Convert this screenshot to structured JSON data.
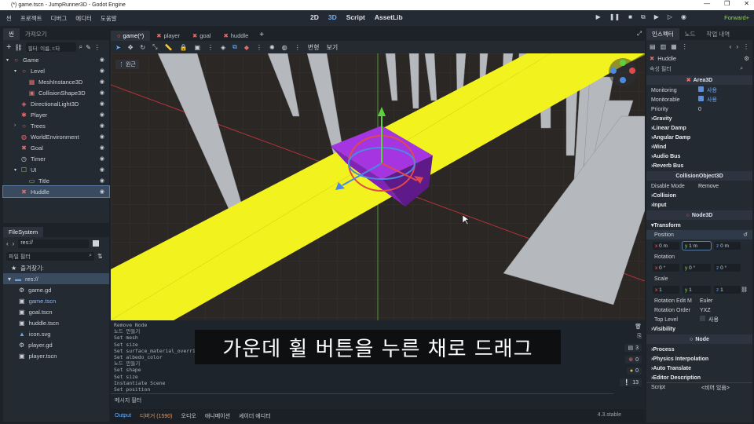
{
  "window": {
    "title": "(*) game.tscn - JumpRunner3D - Godot Engine"
  },
  "menu": {
    "items": [
      "씬",
      "프로젝트",
      "디버그",
      "에디터",
      "도움말"
    ],
    "modes": [
      "2D",
      "3D",
      "Script",
      "AssetLib"
    ],
    "active_mode": "3D",
    "renderer": "Forward+"
  },
  "scene_panel": {
    "tabs": [
      "씬",
      "가져오기"
    ],
    "filter_placeholder": "필터: 이름, t:타",
    "nodes": [
      {
        "label": "Game",
        "depth": 0,
        "icon": "node3d-icon",
        "color": "#e06c6c"
      },
      {
        "label": "Level",
        "depth": 1,
        "icon": "node3d-icon",
        "color": "#e06c6c"
      },
      {
        "label": "MeshInstance3D",
        "depth": 2,
        "icon": "mesh-icon",
        "color": "#e06c6c"
      },
      {
        "label": "CollisionShape3D",
        "depth": 2,
        "icon": "collision-icon",
        "color": "#e06c6c"
      },
      {
        "label": "DirectionalLight3D",
        "depth": 1,
        "icon": "light-icon",
        "color": "#e06c6c"
      },
      {
        "label": "Player",
        "depth": 1,
        "icon": "character-icon",
        "color": "#e06c6c"
      },
      {
        "label": "Trees",
        "depth": 1,
        "icon": "node3d-icon",
        "color": "#e06c6c"
      },
      {
        "label": "WorldEnvironment",
        "depth": 1,
        "icon": "world-icon",
        "color": "#e06c6c"
      },
      {
        "label": "Goal",
        "depth": 1,
        "icon": "area-icon",
        "color": "#e06c6c"
      },
      {
        "label": "Timer",
        "depth": 1,
        "icon": "timer-icon",
        "color": "#cfd4da"
      },
      {
        "label": "UI",
        "depth": 1,
        "icon": "control-icon",
        "color": "#8fd35b"
      },
      {
        "label": "Title",
        "depth": 2,
        "icon": "label-icon",
        "color": "#8fd35b"
      },
      {
        "label": "Huddle",
        "depth": 1,
        "icon": "area-icon",
        "color": "#e06c6c",
        "selected": true
      }
    ]
  },
  "filesystem": {
    "tab": "FileSystem",
    "path": "res://",
    "filter_placeholder": "파일 필터",
    "favorites": "즐겨찾기:",
    "root": "res://",
    "files": [
      "game.gd",
      "game.tscn",
      "goal.tscn",
      "huddle.tscn",
      "icon.svg",
      "player.gd",
      "player.tscn"
    ],
    "highlighted": "game.tscn"
  },
  "editor_tabs": [
    "game(*)",
    "player",
    "goal",
    "huddle"
  ],
  "viewport": {
    "view_label": "원근",
    "toolbar_labels": [
      "변형",
      "보기"
    ]
  },
  "output": {
    "lines": [
      "Remove Node",
      "노드 만들기",
      "Set mesh",
      "Set size",
      "Set surface_material_overri",
      "Set albedo_color",
      "노드 만들기",
      "Set shape",
      "Set size",
      "Instantiate Scene",
      "Set position"
    ],
    "filter_placeholder": "메시지 필터",
    "bottom_tabs": [
      "Output",
      "디버거 (1590)",
      "오디오",
      "애니메이션",
      "셰이더 에디터"
    ],
    "version": "4.3.stable",
    "counts": [
      "3",
      "0",
      "0",
      "13"
    ]
  },
  "subtitle": "가운데 휠 버튼을 누른 채로 드래그",
  "inspector": {
    "tabs": [
      "인스펙터",
      "노드",
      "작업 내역"
    ],
    "node_name": "Huddle",
    "filter_placeholder": "속성 필터",
    "area3d": "Area3D",
    "monitoring_label": "Monitoring",
    "monitoring_value": "사용",
    "monitorable_label": "Monitorable",
    "monitorable_value": "사용",
    "priority_label": "Priority",
    "priority_value": "0",
    "area_sections": [
      "Gravity",
      "Linear Damp",
      "Angular Damp",
      "Wind",
      "Audio Bus",
      "Reverb Bus"
    ],
    "collision_object": "CollisionObject3D",
    "disable_mode_label": "Disable Mode",
    "disable_mode_value": "Remove",
    "collision_sections": [
      "Collision",
      "Input"
    ],
    "node3d": "Node3D",
    "transform": "Transform",
    "position_label": "Position",
    "position": {
      "x": "0 m",
      "y": "1 m",
      "z": "0 m"
    },
    "rotation_label": "Rotation",
    "rotation": {
      "x": "0 °",
      "y": "0 °",
      "z": "0 °"
    },
    "scale_label": "Scale",
    "scale": {
      "x": "1",
      "y": "1",
      "z": "1"
    },
    "rotation_edit_label": "Rotation Edit M",
    "rotation_edit_value": "Euler",
    "rotation_order_label": "Rotation Order",
    "rotation_order_value": "YXZ",
    "top_level_label": "Top Level",
    "top_level_value": "사용",
    "visibility": "Visibility",
    "node": "Node",
    "node_sections": [
      "Process",
      "Physics Interpolation",
      "Auto Translate",
      "Editor Description"
    ],
    "script_label": "Script",
    "script_value": "<비어 있음>"
  }
}
